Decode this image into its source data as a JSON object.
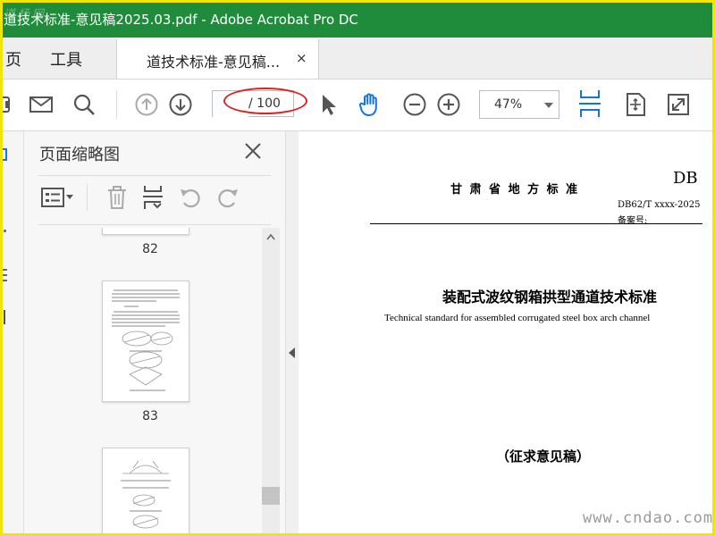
{
  "titlebar": {
    "title": "道技术标准-意见稿2025.03.pdf - Adobe Acrobat Pro DC",
    "watermark": "道杨网"
  },
  "menubar": {
    "items": [
      "页",
      "工具"
    ],
    "document_tab": "道技术标准-意见稿...",
    "tab_close": "×"
  },
  "toolbar": {
    "page_current": "",
    "page_total": "/ 100",
    "zoom": "47%",
    "icons": [
      "save-icon",
      "mail-icon",
      "search-icon",
      "prev-page-icon",
      "next-page-icon",
      "select-icon",
      "hand-icon",
      "zoom-out-icon",
      "zoom-in-icon",
      "scroll-mode-icon",
      "fit-page-icon",
      "full-screen-icon"
    ]
  },
  "thumbnails_panel": {
    "title": "页面缩略图",
    "close": "close-icon",
    "pages": [
      {
        "number": "82"
      },
      {
        "number": "83"
      },
      {
        "number": ""
      }
    ]
  },
  "document": {
    "header_chinese": "甘 肃 省 地 方 标 准",
    "db_code": "DB",
    "std_number": "DB62/T xxxx-2025",
    "filing_number": "备案号:",
    "title_cn": "装配式波纹钢箱拱型通道技术标准",
    "title_en": "Technical standard for assembled corrugated steel box arch channel",
    "draft_note": "（征求意见稿）"
  },
  "site_watermark": "www.cndao.com",
  "colors": {
    "titlebar": "#1e8c3b",
    "accent_blue": "#1473e6",
    "highlight_red": "#e02020",
    "frame_yellow": "#f2e600"
  }
}
